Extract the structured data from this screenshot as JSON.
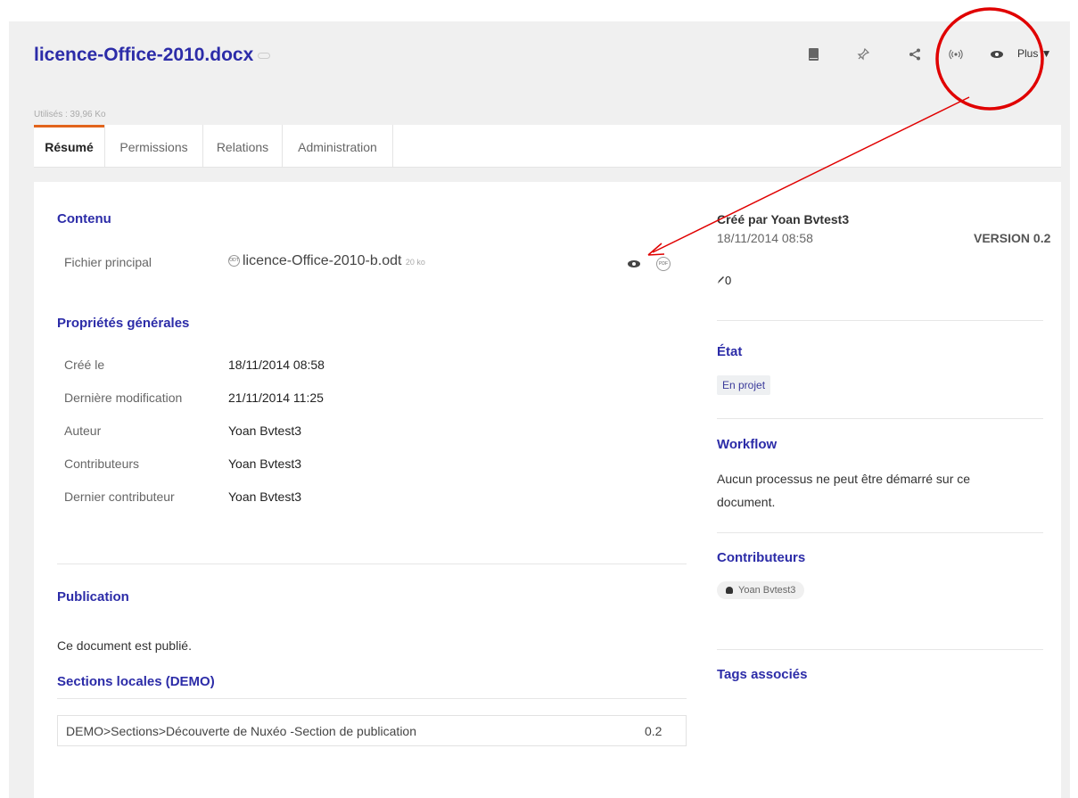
{
  "document": {
    "title": "licence-Office-2010.docx",
    "usage": "Utilisés : 39,96 Ko"
  },
  "toolbar": {
    "icons": [
      "book-icon",
      "pin-icon",
      "share-icon",
      "broadcast-icon",
      "eye-icon"
    ],
    "more_label": "Plus ▼"
  },
  "tabs": [
    {
      "label": "Résumé",
      "active": true
    },
    {
      "label": "Permissions",
      "active": false
    },
    {
      "label": "Relations",
      "active": false
    },
    {
      "label": "Administration",
      "active": false
    }
  ],
  "content": {
    "title": "Contenu",
    "main_file_label": "Fichier principal",
    "file_badge": "ODT",
    "file_name": "licence-Office-2010-b.odt",
    "file_size": "20 ko",
    "pdf_badge": "PDF"
  },
  "properties": {
    "title": "Propriétés générales",
    "rows": [
      {
        "label": "Créé le",
        "value": "18/11/2014 08:58"
      },
      {
        "label": "Dernière modification",
        "value": "21/11/2014 11:25"
      },
      {
        "label": "Auteur",
        "value": "Yoan Bvtest3"
      },
      {
        "label": "Contributeurs",
        "value": "Yoan Bvtest3"
      },
      {
        "label": "Dernier contributeur",
        "value": "Yoan Bvtest3"
      }
    ]
  },
  "publication": {
    "title": "Publication",
    "status": "Ce document est publié.",
    "sections_title": "Sections locales (DEMO)",
    "sections": [
      {
        "path": "DEMO>Sections>Découverte de Nuxéo -Section de publication",
        "version": "0.2"
      }
    ]
  },
  "sidebar": {
    "created_by": "Créé par Yoan Bvtest3",
    "created_date": "18/11/2014 08:58",
    "version": "VERSION 0.2",
    "edit_count": "0",
    "state_title": "État",
    "state_badge": "En projet",
    "workflow_title": "Workflow",
    "workflow_text_1": "Aucun processus ne peut être démarré sur ce",
    "workflow_text_2": "document.",
    "contributors_title": "Contributeurs",
    "contributor": "Yoan Bvtest3",
    "tags_title": "Tags associés"
  },
  "colors": {
    "title_blue": "#2c2ca8",
    "tab_accent": "#e2641c",
    "annotation_red": "#e00000"
  }
}
